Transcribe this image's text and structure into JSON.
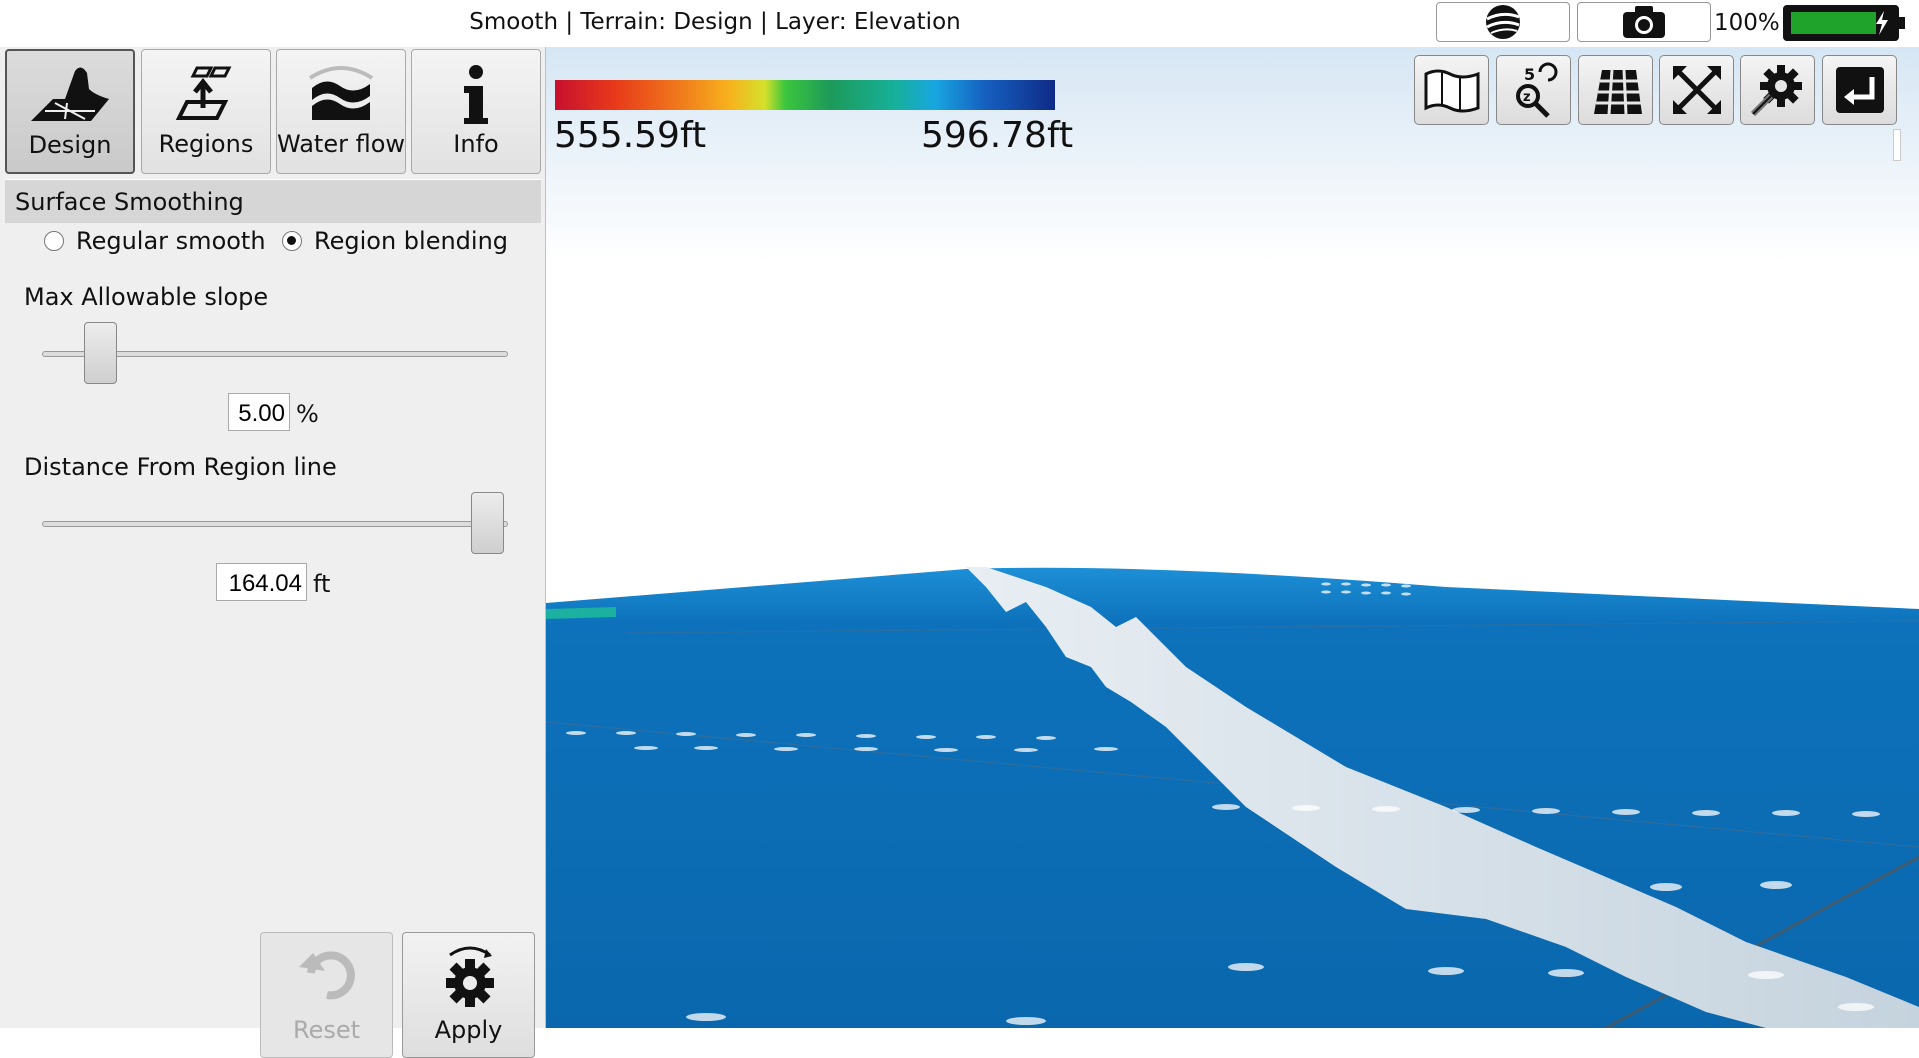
{
  "window": {
    "title": "Smooth | Terrain: Design | Layer: Elevation"
  },
  "status": {
    "battery_percent": "100%",
    "battery_level": 0.85
  },
  "topbar_icons": [
    "globe-icon",
    "camera-icon",
    "battery-icon"
  ],
  "tabs": [
    {
      "label": "Design",
      "icon": "design-icon",
      "active": true
    },
    {
      "label": "Regions",
      "icon": "regions-icon",
      "active": false
    },
    {
      "label": "Water flow",
      "icon": "water-flow-icon",
      "active": false
    },
    {
      "label": "Info",
      "icon": "info-icon",
      "active": false
    }
  ],
  "panel": {
    "section_title": "Surface Smoothing",
    "radio_regular": "Regular smooth",
    "radio_blending": "Region blending",
    "selected_mode": "Region blending",
    "slope_label": "Max Allowable slope",
    "slope_value": "5.00",
    "slope_unit": "%",
    "slope_slider_fraction": 0.05,
    "distance_label": "Distance From Region line",
    "distance_value": "164.04",
    "distance_unit": "ft",
    "distance_slider_fraction": 1.0,
    "reset_label": "Reset",
    "apply_label": "Apply"
  },
  "legend": {
    "min": "555.59ft",
    "max": "596.78ft",
    "colors": [
      "#c8102e",
      "#f07a1c",
      "#f7b21d",
      "#d5e02c",
      "#3cc63c",
      "#16b09a",
      "#18a6e0",
      "#1660c0",
      "#0f2a86"
    ]
  },
  "toolbar": [
    "map-icon",
    "zoom-extents-icon",
    "grid-icon",
    "fullscreen-icon",
    "settings-icon",
    "exit-icon"
  ],
  "colors": {
    "terrain": "#0b6fb5",
    "ridge": "#dbe6ee",
    "sky_top": "#dbe9f5"
  }
}
